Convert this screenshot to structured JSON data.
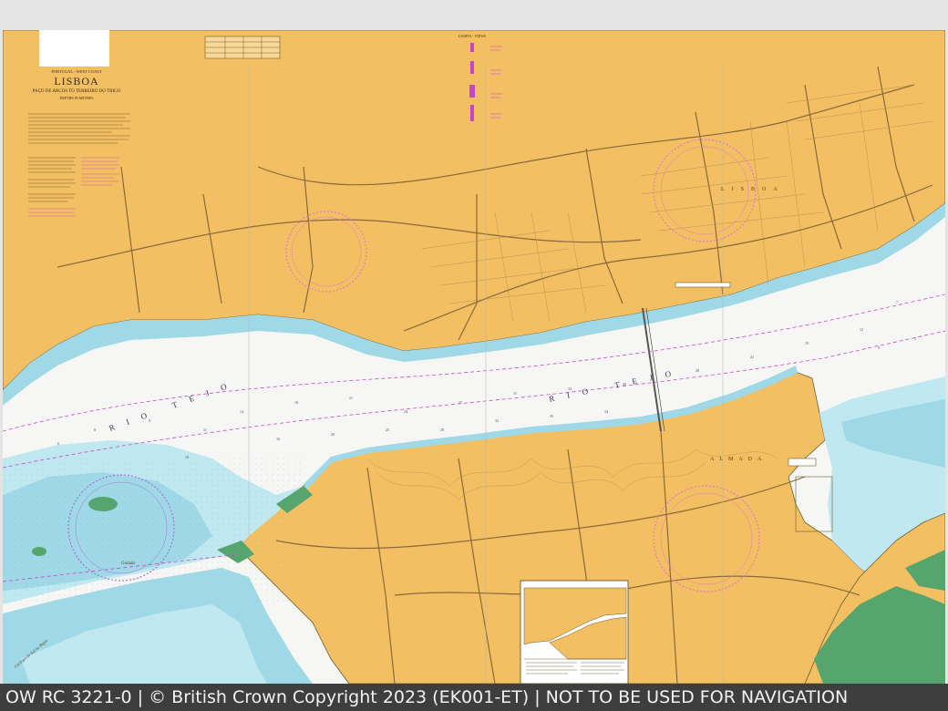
{
  "chart": {
    "region_line": "PORTUGAL - WEST COAST",
    "title": "LISBOA",
    "subtitle": "PAÇO DE ARCOS TO TERREIRO DO TRIGO",
    "depths_line": "DEPTHS IN METRES",
    "lights_title": "LIGHTS - VIEWS"
  },
  "labels": {
    "rio_tejo_lower": "RIO TEJO",
    "rio_tejo_mid": "RIO TEJO",
    "lisboa_city": "LISBOA",
    "almada": "ALMADA",
    "golada": "Golada",
    "cachopo": "Cachopo do Sul ou Bugio"
  },
  "colors": {
    "land": "#f2bf63",
    "deep_water": "#ffffff",
    "shallow_water": "#bfe8f0",
    "medium_water": "#9fd8e6",
    "drying": "#56a56e",
    "magenta": "#c846c8",
    "road": "#8a6a3a",
    "footer_bg": "#3e3e3e"
  },
  "footer": {
    "text": "OW RC 3221-0 | © British Crown Copyright 2023 (EK001-ET) | NOT TO BE USED FOR NAVIGATION"
  }
}
